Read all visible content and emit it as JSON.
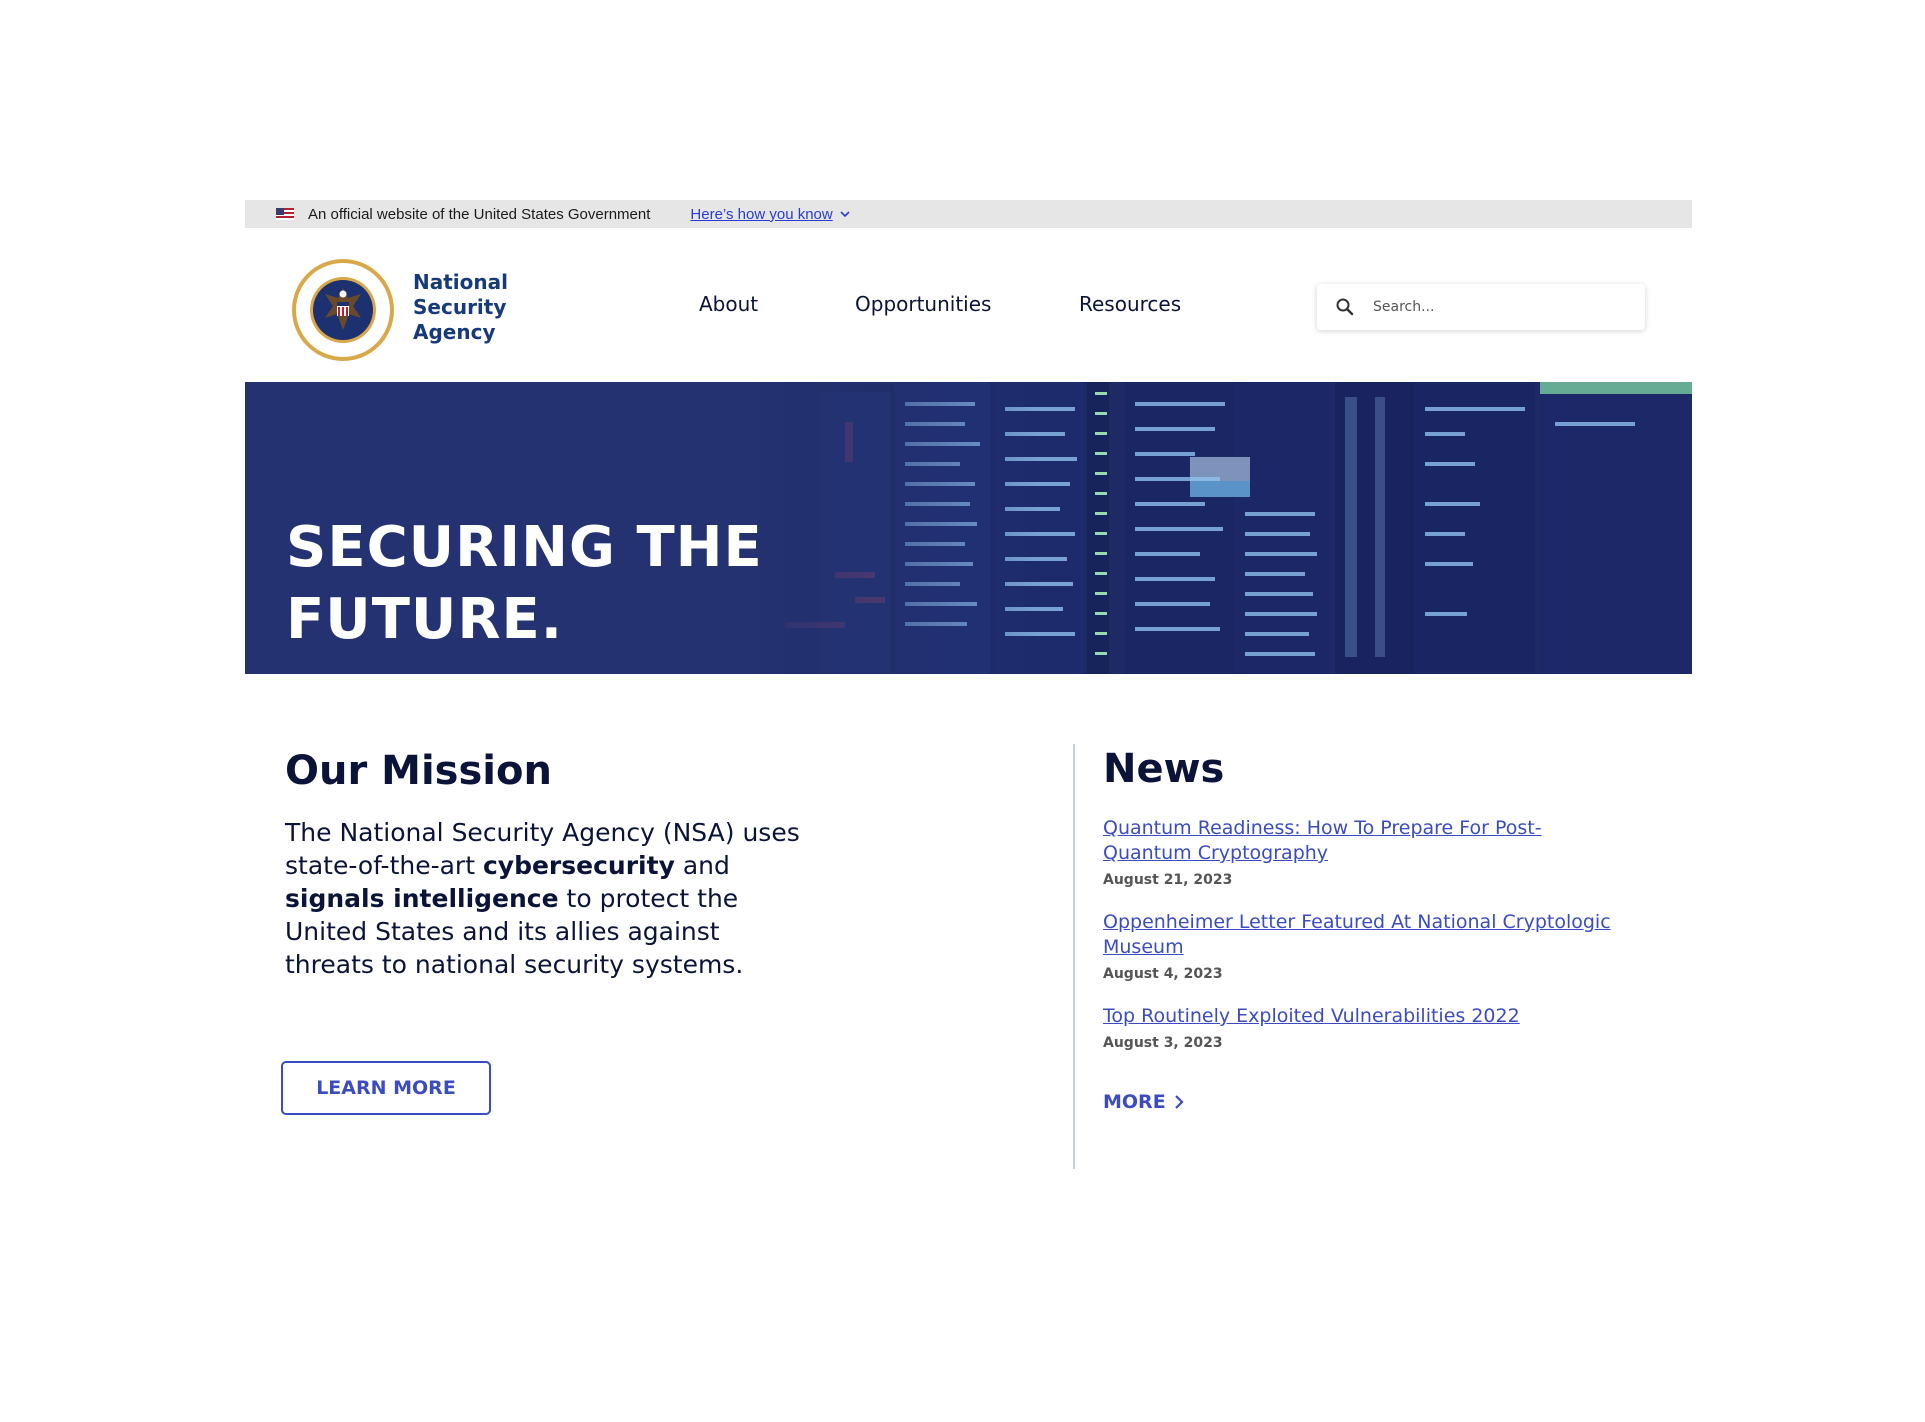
{
  "gov_banner": {
    "text": "An official website of the United States Government",
    "link": "Here’s how you know"
  },
  "header": {
    "brand_line1": "National",
    "brand_line2": "Security",
    "brand_line3": "Agency",
    "nav": [
      "About",
      "Opportunities",
      "Resources"
    ],
    "search_placeholder": "Search..."
  },
  "hero": {
    "title_line1": "SECURING THE",
    "title_line2": "FUTURE."
  },
  "mission": {
    "heading": "Our Mission",
    "text_1": "The National Security Agency (NSA) uses state-of-the-art ",
    "bold_1": "cybersecurity",
    "text_2": " and ",
    "bold_2": "signals intelligence",
    "text_3": " to protect the United States and its allies against threats to national security systems.",
    "button": "LEARN MORE"
  },
  "news": {
    "heading": "News",
    "items": [
      {
        "title": "Quantum Readiness: How To Prepare For Post-Quantum Cryptography",
        "date": "August 21, 2023"
      },
      {
        "title": "Oppenheimer Letter Featured At National Cryptologic Museum",
        "date": "August 4, 2023"
      },
      {
        "title": "Top Routinely Exploited Vulnerabilities 2022",
        "date": "August 3, 2023"
      }
    ],
    "more": "MORE"
  },
  "colors": {
    "navy": "#0b1438",
    "brand_blue": "#163a7a",
    "link_blue": "#3b4cc0",
    "hero_bg": "#1f2d6a",
    "banner_bg": "#e6e6e6"
  }
}
